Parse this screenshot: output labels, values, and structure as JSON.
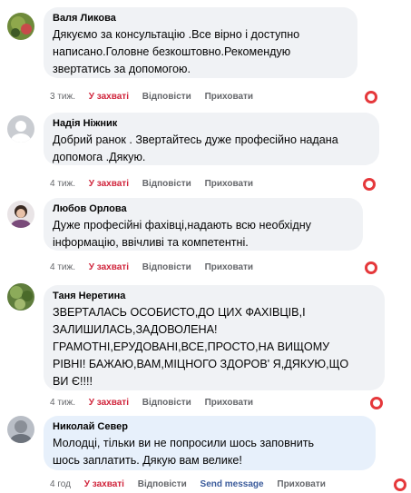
{
  "comments": [
    {
      "author": "Валя Ликова",
      "lines": [
        "Дякуємо за консультацію .Все вірно і доступно",
        "написано.Головне безкоштовно.Рекомендую",
        "звертатись за допомогою."
      ],
      "time": "3 тиж.",
      "like": "У захваті",
      "reply": "Відповісти",
      "hide": "Приховати",
      "reaction_icon": "heart-reaction-icon"
    },
    {
      "author": "Надія Ніжник",
      "lines": [
        "Добрий ранок . Звертайтесь дуже професійно надана",
        "допомога .Дякую."
      ],
      "time": "4 тиж.",
      "like": "У захваті",
      "reply": "Відповісти",
      "hide": "Приховати",
      "reaction_icon": "heart-reaction-icon"
    },
    {
      "author": "Любов Орлова",
      "lines": [
        "Дуже професійні фахівці,надають всю необхідну",
        "інформацію, ввічливі та компетентні."
      ],
      "time": "4 тиж.",
      "like": "У захваті",
      "reply": "Відповісти",
      "hide": "Приховати",
      "reaction_icon": "heart-reaction-icon"
    },
    {
      "author": "Таня Неретина",
      "lines": [
        "ЗВЕРТАЛАСЬ ОСОБИСТО,ДО ЦИХ ФАХІВЦІВ,І",
        "ЗАЛИШИЛАСЬ,ЗАДОВОЛЕНА!",
        "ГРАМОТНІ,ЕРУДОВАНІ,ВСЕ,ПРОСТО,НА ВИЩОМУ",
        "РІВНІ! БАЖАЮ,ВАМ,МІЦНОГО ЗДОРОВ' Я,ДЯКУЮ,ЩО",
        "ВИ Є!!!!"
      ],
      "time": "4 тиж.",
      "like": "У захваті",
      "reply": "Відповісти",
      "hide": "Приховати",
      "reaction_icon": "heart-reaction-icon"
    },
    {
      "author": "Николай Север",
      "lines": [
        "Молодці, тільки ви не попросили шось заповнить",
        "шось заплатить. Дякую вам велике!"
      ],
      "time": "4 год",
      "like": "У захваті",
      "reply": "Відповісти",
      "send": "Send message",
      "hide": "Приховати",
      "reaction_icon": "heart-reaction-icon"
    }
  ],
  "colors": {
    "bubble": "#f0f2f5",
    "bubble_highlight": "#e7f0fb",
    "like": "#d0243b",
    "send": "#3b5b9b",
    "heart": "#e5383b"
  }
}
